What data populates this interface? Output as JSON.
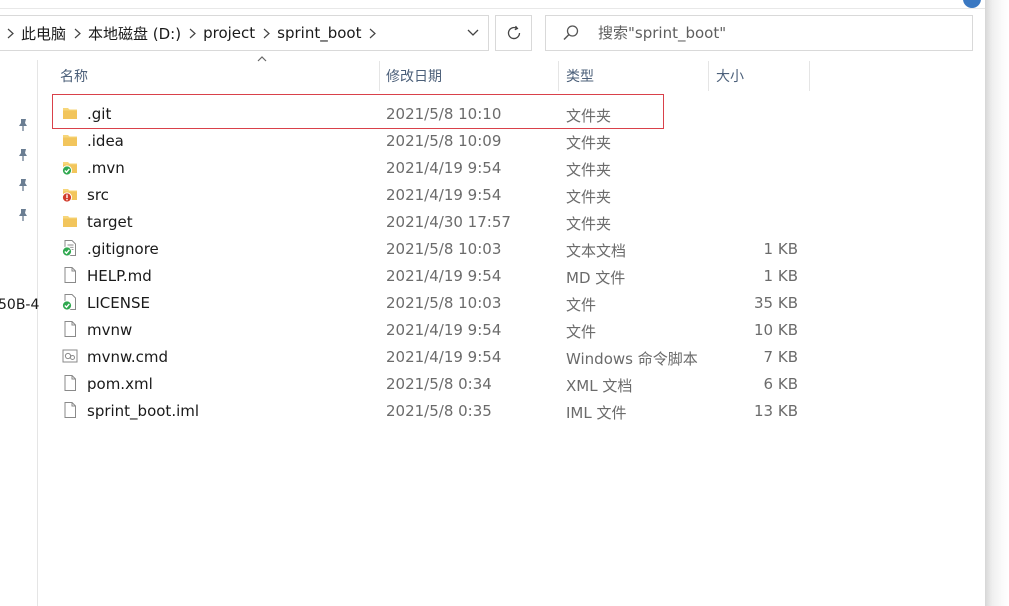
{
  "breadcrumb": {
    "items": [
      "此电脑",
      "本地磁盘 (D:)",
      "project",
      "sprint_boot"
    ]
  },
  "search": {
    "placeholder": "搜索\"sprint_boot\""
  },
  "nav": {
    "partial_label": "50B-4"
  },
  "columns": {
    "name": "名称",
    "date": "修改日期",
    "type": "类型",
    "size": "大小"
  },
  "files": [
    {
      "name": ".git",
      "date": "2021/5/8 10:10",
      "type": "文件夹",
      "size": "",
      "icon": "folder-icon"
    },
    {
      "name": ".idea",
      "date": "2021/5/8 10:09",
      "type": "文件夹",
      "size": "",
      "icon": "folder-icon"
    },
    {
      "name": ".mvn",
      "date": "2021/4/19 9:54",
      "type": "文件夹",
      "size": "",
      "icon": "folder-synced-icon"
    },
    {
      "name": "src",
      "date": "2021/4/19 9:54",
      "type": "文件夹",
      "size": "",
      "icon": "folder-error-icon"
    },
    {
      "name": "target",
      "date": "2021/4/30 17:57",
      "type": "文件夹",
      "size": "",
      "icon": "folder-icon"
    },
    {
      "name": ".gitignore",
      "date": "2021/5/8 10:03",
      "type": "文本文档",
      "size": "1 KB",
      "icon": "text-file-synced-icon"
    },
    {
      "name": "HELP.md",
      "date": "2021/4/19 9:54",
      "type": "MD 文件",
      "size": "1 KB",
      "icon": "file-icon"
    },
    {
      "name": "LICENSE",
      "date": "2021/5/8 10:03",
      "type": "文件",
      "size": "35 KB",
      "icon": "file-synced-icon"
    },
    {
      "name": "mvnw",
      "date": "2021/4/19 9:54",
      "type": "文件",
      "size": "10 KB",
      "icon": "file-icon"
    },
    {
      "name": "mvnw.cmd",
      "date": "2021/4/19 9:54",
      "type": "Windows 命令脚本",
      "size": "7 KB",
      "icon": "script-file-icon"
    },
    {
      "name": "pom.xml",
      "date": "2021/5/8 0:34",
      "type": "XML 文档",
      "size": "6 KB",
      "icon": "file-icon"
    },
    {
      "name": "sprint_boot.iml",
      "date": "2021/5/8 0:35",
      "type": "IML 文件",
      "size": "13 KB",
      "icon": "file-icon"
    }
  ],
  "colors": {
    "folder": "#f2c55c",
    "highlight": "#d9414a",
    "sync_ok": "#2fa84f",
    "sync_error": "#d13a2a"
  }
}
